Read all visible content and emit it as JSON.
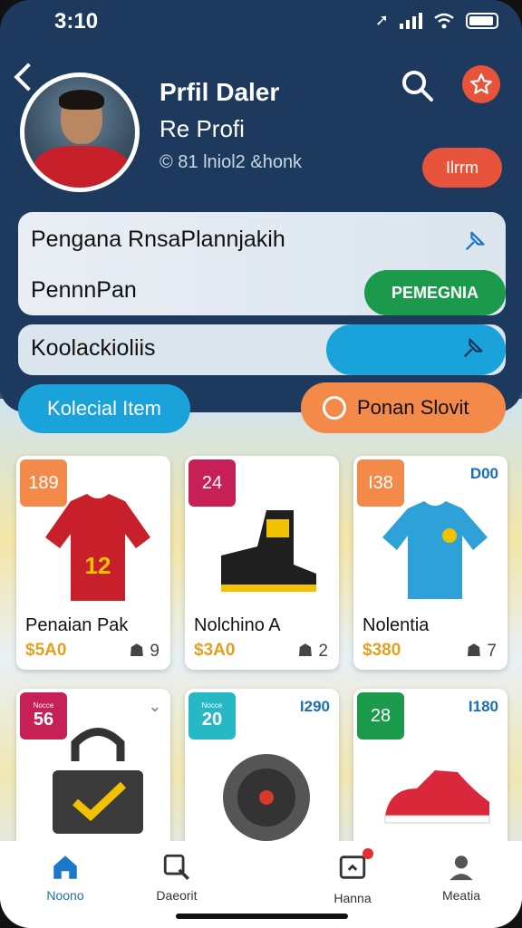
{
  "status": {
    "time": "3:10"
  },
  "header": {
    "title": "Prfil Daler",
    "subtitle": "Re Profi",
    "meta": "© 81 lniol2 &honk",
    "action_label": "Ilrrm"
  },
  "info_card": {
    "line1": "Pengana RnsaPlannjakih",
    "line2": "PennnPan",
    "button": "PEMEGNIA"
  },
  "collection_card": {
    "label": "Koolackioliis"
  },
  "tabs": {
    "left": "Kolecial Item",
    "right": "Ponan Slovit"
  },
  "items": [
    {
      "badge": "189",
      "badge_color": "#f48a4a",
      "corner": "",
      "name": "Penaian Pak",
      "price": "$5A0",
      "likes": "9"
    },
    {
      "badge": "24",
      "badge_color": "#c62057",
      "corner": "",
      "name": "Nolchino A",
      "price": "$3A0",
      "likes": "2"
    },
    {
      "badge": "I38",
      "badge_color": "#f48a4a",
      "corner": "D00",
      "name": "Nolentia",
      "price": "$380",
      "likes": "7"
    },
    {
      "badge_top": "Nocce",
      "badge": "56",
      "badge_color": "#c62057",
      "corner": "",
      "name": "",
      "price": "",
      "likes": ""
    },
    {
      "badge_top": "Nocce",
      "badge": "20",
      "badge_color": "#27b8c6",
      "corner": "I290",
      "name": "",
      "price": "",
      "likes": ""
    },
    {
      "badge": "28",
      "badge_color": "#1b9a4c",
      "corner": "I180",
      "name": "",
      "price": "",
      "likes": ""
    }
  ],
  "nav": [
    {
      "label": "Noono"
    },
    {
      "label": "Daeorit"
    },
    {
      "label": "Hanna"
    },
    {
      "label": "Meatia"
    }
  ]
}
